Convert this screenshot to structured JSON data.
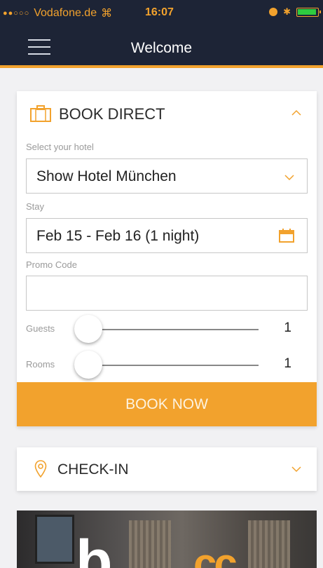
{
  "status_bar": {
    "carrier": "Vodafone.de",
    "time": "16:07"
  },
  "header": {
    "title": "Welcome"
  },
  "book_direct": {
    "title": "BOOK DIRECT",
    "hotel_label": "Select your hotel",
    "hotel_value": "Show Hotel München",
    "stay_label": "Stay",
    "stay_value": "Feb 15 - Feb 16 (1 night)",
    "promo_label": "Promo Code",
    "promo_value": "",
    "guests_label": "Guests",
    "guests_value": "1",
    "rooms_label": "Rooms",
    "rooms_value": "1",
    "book_button": "BOOK NOW"
  },
  "check_in": {
    "title": "CHECK-IN"
  },
  "promo_image": {
    "logo_text": "b",
    "logo_accent": "cc"
  },
  "colors": {
    "accent": "#f2a22d",
    "header_bg": "#1d2436"
  }
}
